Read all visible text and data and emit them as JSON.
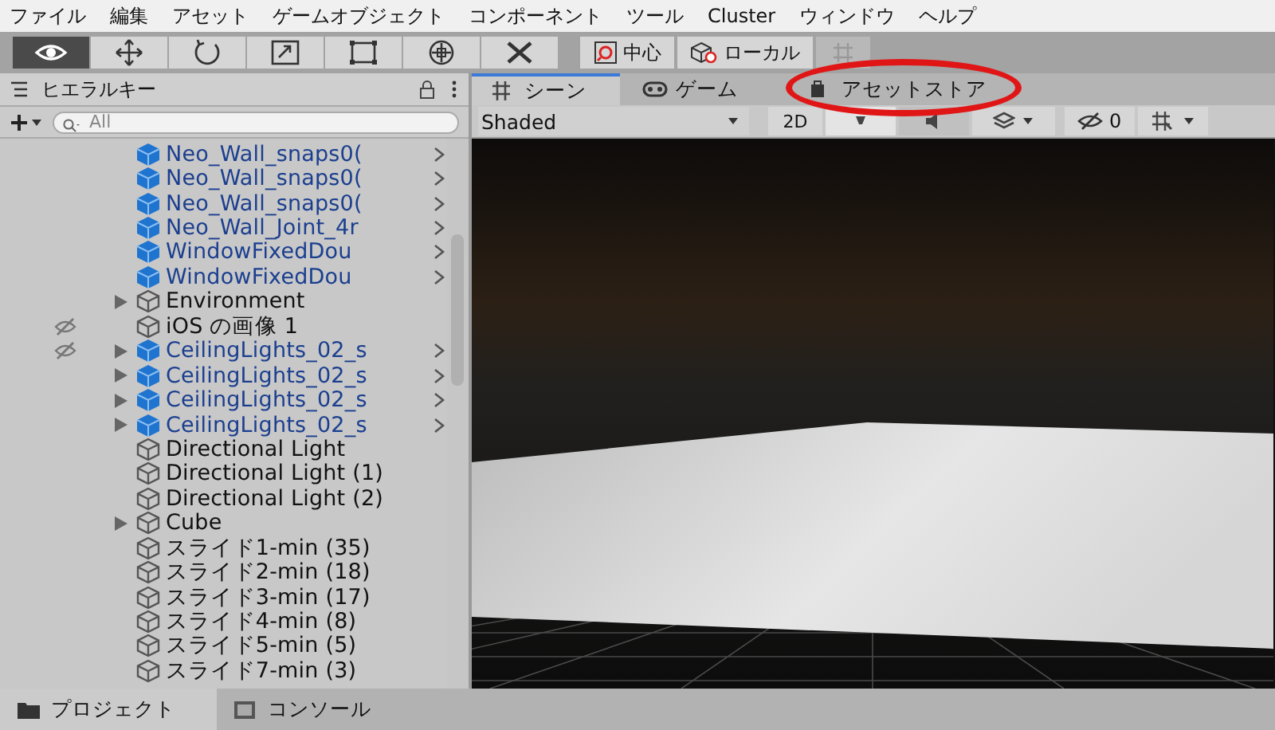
{
  "menu": [
    "ファイル",
    "編集",
    "アセット",
    "ゲームオブジェクト",
    "コンポーネント",
    "ツール",
    "Cluster",
    "ウィンドウ",
    "ヘルプ"
  ],
  "toolbar": {
    "tools": [
      {
        "kind": "view",
        "selected": true
      },
      {
        "kind": "move",
        "selected": false
      },
      {
        "kind": "rotate",
        "selected": false
      },
      {
        "kind": "scale",
        "selected": false
      },
      {
        "kind": "rect",
        "selected": false
      },
      {
        "kind": "transform",
        "selected": false
      },
      {
        "kind": "custom",
        "selected": false
      }
    ],
    "pivot": "中心",
    "space": "ローカル",
    "grid_snap_disabled": true
  },
  "hierarchy": {
    "title": "ヒエラルキー",
    "search": {
      "placeholder": "All"
    },
    "items": [
      {
        "name": "Neo_Wall_snaps0(",
        "kind": "prefab",
        "expandable": false,
        "hidden": false
      },
      {
        "name": "Neo_Wall_snaps0(",
        "kind": "prefab",
        "expandable": false,
        "hidden": false
      },
      {
        "name": "Neo_Wall_snaps0(",
        "kind": "prefab",
        "expandable": false,
        "hidden": false
      },
      {
        "name": "Neo_Wall_Joint_4r",
        "kind": "prefab",
        "expandable": false,
        "hidden": false
      },
      {
        "name": "WindowFixedDou",
        "kind": "prefab",
        "expandable": false,
        "hidden": false
      },
      {
        "name": "WindowFixedDou",
        "kind": "prefab",
        "expandable": false,
        "hidden": false
      },
      {
        "name": "Environment",
        "kind": "object",
        "expandable": true,
        "hidden": false
      },
      {
        "name": "iOS の画像 1",
        "kind": "object",
        "expandable": false,
        "hidden": true
      },
      {
        "name": "CeilingLights_02_s",
        "kind": "prefab",
        "expandable": true,
        "hidden": true
      },
      {
        "name": "CeilingLights_02_s",
        "kind": "prefab",
        "expandable": true,
        "hidden": false
      },
      {
        "name": "CeilingLights_02_s",
        "kind": "prefab",
        "expandable": true,
        "hidden": false
      },
      {
        "name": "CeilingLights_02_s",
        "kind": "prefab",
        "expandable": true,
        "hidden": false
      },
      {
        "name": "Directional Light",
        "kind": "object",
        "expandable": false,
        "hidden": false
      },
      {
        "name": "Directional Light (1)",
        "kind": "object",
        "expandable": false,
        "hidden": false
      },
      {
        "name": "Directional Light (2)",
        "kind": "object",
        "expandable": false,
        "hidden": false
      },
      {
        "name": "Cube",
        "kind": "object",
        "expandable": true,
        "hidden": false
      },
      {
        "name": "スライド1-min (35)",
        "kind": "object",
        "expandable": false,
        "hidden": false
      },
      {
        "name": "スライド2-min (18)",
        "kind": "object",
        "expandable": false,
        "hidden": false
      },
      {
        "name": "スライド3-min (17)",
        "kind": "object",
        "expandable": false,
        "hidden": false
      },
      {
        "name": "スライド4-min (8)",
        "kind": "object",
        "expandable": false,
        "hidden": false
      },
      {
        "name": "スライド5-min (5)",
        "kind": "object",
        "expandable": false,
        "hidden": false
      },
      {
        "name": "スライド7-min (3)",
        "kind": "object",
        "expandable": false,
        "hidden": false
      }
    ]
  },
  "scene_tabs": [
    {
      "label": "シーン",
      "kind": "scene",
      "selected": true,
      "highlighted": false
    },
    {
      "label": "ゲーム",
      "kind": "game",
      "selected": false,
      "highlighted": false
    },
    {
      "label": "アセットストア",
      "kind": "store",
      "selected": false,
      "highlighted": true
    }
  ],
  "scene_toolbar": {
    "shading": "Shaded",
    "mode_2d": "2D",
    "hidden_count": "0"
  },
  "bottom_tabs": [
    {
      "label": "プロジェクト",
      "kind": "project",
      "selected": true
    },
    {
      "label": "コンソール",
      "kind": "console",
      "selected": false
    }
  ]
}
